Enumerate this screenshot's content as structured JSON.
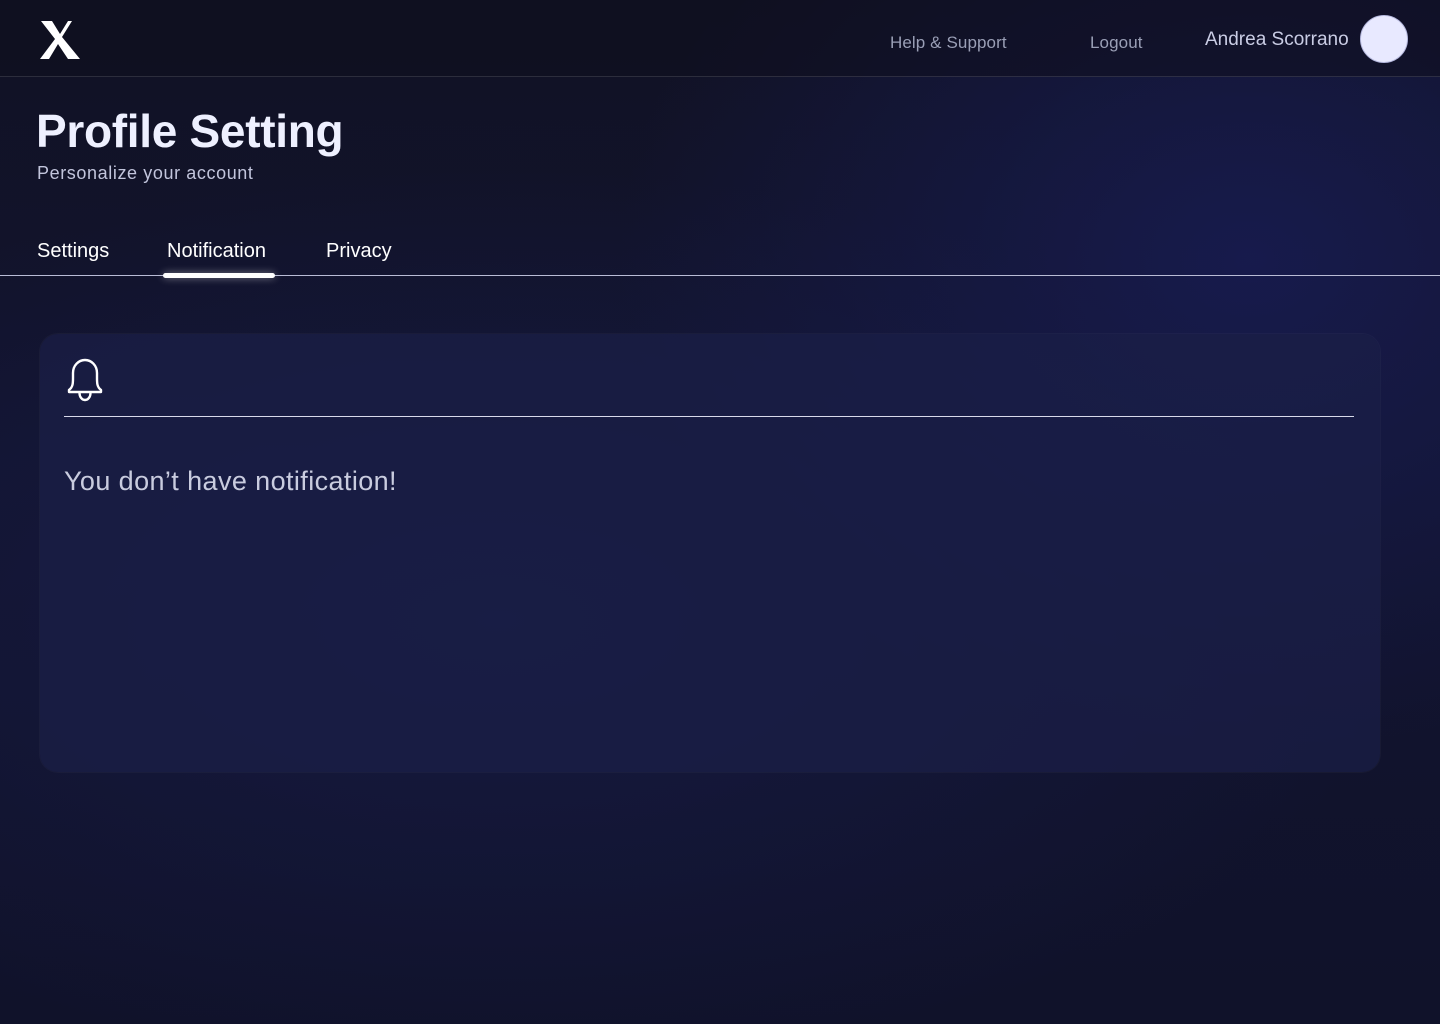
{
  "header": {
    "help_label": "Help & Support",
    "logout_label": "Logout",
    "user_name": "Andrea Scorrano",
    "logo_icon": "x-logo-icon",
    "avatar_color": "#e8e9ff"
  },
  "page": {
    "title": "Profile Setting",
    "subtitle": "Personalize your account"
  },
  "tabs": [
    {
      "label": "Settings",
      "active": false
    },
    {
      "label": "Notification",
      "active": true
    },
    {
      "label": "Privacy",
      "active": false
    }
  ],
  "notifications": {
    "icon": "bell-icon",
    "empty_message": "You don’t have notification!"
  },
  "colors": {
    "background": "#121430",
    "panel": "#1a1f46",
    "accent": "#ffffff",
    "muted_text": "#9a9fb6"
  }
}
